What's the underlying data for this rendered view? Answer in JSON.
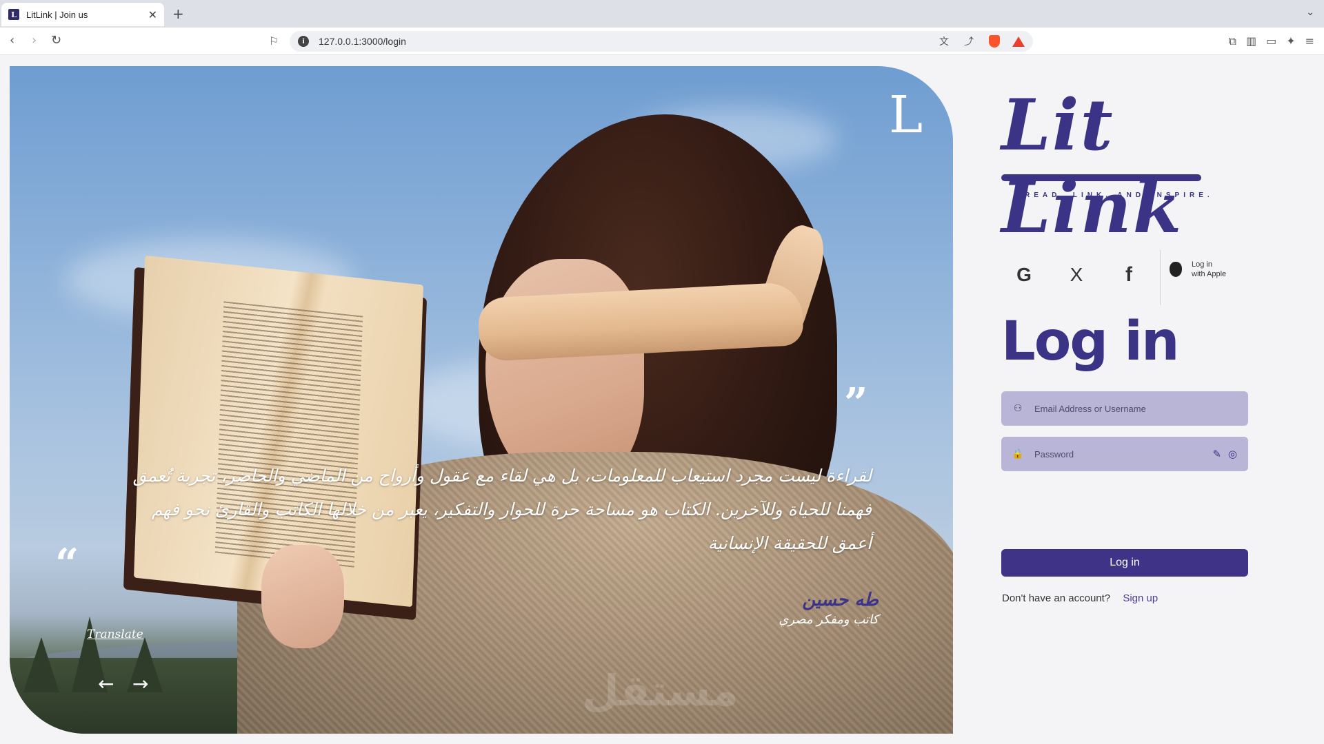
{
  "browser": {
    "tab_title": "LitLink | Join us",
    "tab_close": "✕",
    "new_tab": "+",
    "url": "127.0.0.1:3000/login"
  },
  "hero": {
    "corner_logo": "L",
    "quote_open_mark": "“",
    "quote_close_mark": "”",
    "quote": "لقراءة ليست مجرد استيعاب للمعلومات، بل هي لقاء مع عقول وأرواح من الماضي والحاضر، تجربة تُعمق فهمنا للحياة وللآخرين. الكتاب هو مساحة حرة للحوار والتفكير، يعبر من خلالها الكاتب والقارئ نحو فهم أعمق للحقيقة الإنسانية",
    "author_name": "طه حسين",
    "author_title": "كاتب ومفكر مصري",
    "translate": "Translate",
    "prev_arrow": "←",
    "next_arrow": "→",
    "watermark": "مستقل"
  },
  "brand": {
    "name": "Lit Link",
    "tagline": "READ, LINK, AND INSPIRE."
  },
  "social": {
    "google": "G",
    "x": "X",
    "facebook": "f",
    "apple_line1": "Log in",
    "apple_line2": "with Apple"
  },
  "login": {
    "heading": "Log in",
    "email_placeholder": "Email Address or Username",
    "password_placeholder": "Password",
    "button": "Log in",
    "no_account": "Don't have an account?",
    "signup": "Sign up"
  },
  "colors": {
    "brand": "#3b3486",
    "field_bg": "#b9b5d6",
    "button_bg": "#3f3388"
  }
}
